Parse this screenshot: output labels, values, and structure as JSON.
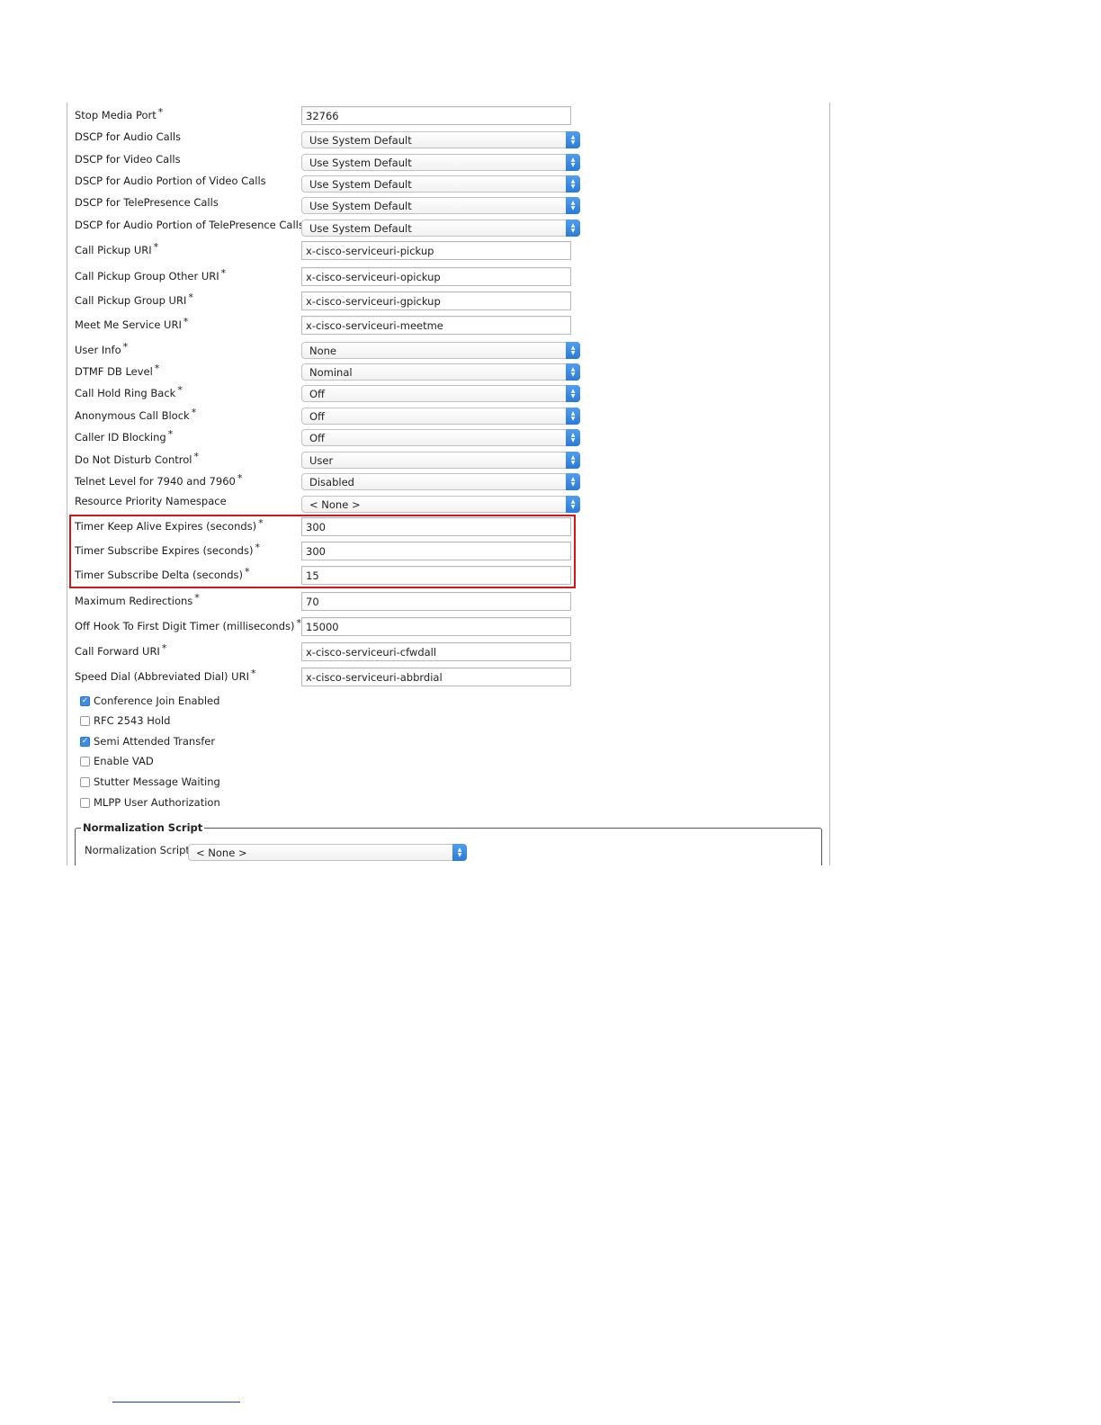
{
  "form": {
    "rows": [
      {
        "label": "Stop Media Port",
        "required": "*",
        "type": "text",
        "value": "32766"
      },
      {
        "label": "DSCP for Audio Calls",
        "required": "",
        "type": "select",
        "value": "Use System Default"
      },
      {
        "label": "DSCP for Video Calls",
        "required": "",
        "type": "select",
        "value": "Use System Default"
      },
      {
        "label": "DSCP for Audio Portion of Video Calls",
        "required": "",
        "type": "select",
        "value": "Use System Default"
      },
      {
        "label": "DSCP for TelePresence Calls",
        "required": "",
        "type": "select",
        "value": "Use System Default"
      },
      {
        "label": "DSCP for Audio Portion of TelePresence Calls",
        "required": "",
        "type": "select",
        "value": "Use System Default"
      },
      {
        "label": "Call Pickup URI",
        "required": "*",
        "type": "text",
        "value": "x-cisco-serviceuri-pickup"
      },
      {
        "label": "Call Pickup Group Other URI",
        "required": "*",
        "type": "text",
        "value": "x-cisco-serviceuri-opickup"
      },
      {
        "label": "Call Pickup Group URI",
        "required": "*",
        "type": "text",
        "value": "x-cisco-serviceuri-gpickup"
      },
      {
        "label": "Meet Me Service URI",
        "required": "*",
        "type": "text",
        "value": "x-cisco-serviceuri-meetme"
      },
      {
        "label": "User Info",
        "required": "*",
        "type": "select",
        "value": "None"
      },
      {
        "label": "DTMF DB Level",
        "required": "*",
        "type": "select",
        "value": "Nominal"
      },
      {
        "label": "Call Hold Ring Back",
        "required": "*",
        "type": "select",
        "value": "Off"
      },
      {
        "label": "Anonymous Call Block",
        "required": "*",
        "type": "select",
        "value": "Off"
      },
      {
        "label": "Caller ID Blocking",
        "required": "*",
        "type": "select",
        "value": "Off"
      },
      {
        "label": "Do Not Disturb Control",
        "required": "*",
        "type": "select",
        "value": "User"
      },
      {
        "label": "Telnet Level for 7940 and 7960",
        "required": "*",
        "type": "select",
        "value": "Disabled"
      },
      {
        "label": "Resource Priority Namespace",
        "required": "",
        "type": "select",
        "value": "< None >"
      },
      {
        "label": "Timer Keep Alive Expires (seconds)",
        "required": "*",
        "type": "text",
        "value": "300"
      },
      {
        "label": "Timer Subscribe Expires (seconds)",
        "required": "*",
        "type": "text",
        "value": "300"
      },
      {
        "label": "Timer Subscribe Delta (seconds)",
        "required": "*",
        "type": "text",
        "value": "15"
      },
      {
        "label": "Maximum Redirections",
        "required": "*",
        "type": "text",
        "value": "70"
      },
      {
        "label": "Off Hook To First Digit Timer (milliseconds)",
        "required": "*",
        "type": "text",
        "value": "15000"
      },
      {
        "label": "Call Forward URI",
        "required": "*",
        "type": "text",
        "value": "x-cisco-serviceuri-cfwdall"
      },
      {
        "label": "Speed Dial (Abbreviated Dial) URI",
        "required": "*",
        "type": "text",
        "value": "x-cisco-serviceuri-abbrdial"
      }
    ],
    "checkboxes": [
      {
        "label": "Conference Join Enabled",
        "checked": true
      },
      {
        "label": "RFC 2543 Hold",
        "checked": false
      },
      {
        "label": "Semi Attended Transfer",
        "checked": true
      },
      {
        "label": "Enable VAD",
        "checked": false
      },
      {
        "label": "Stutter Message Waiting",
        "checked": false
      },
      {
        "label": "MLPP User Authorization",
        "checked": false
      }
    ],
    "normalization": {
      "legend": "Normalization Script",
      "label": "Normalization Script",
      "value": "< None >"
    }
  },
  "colors": {
    "highlight": "#d7141a",
    "select_arrow": "#2a7ad8",
    "checkbox_checked": "#3d8ee6"
  },
  "icons": {
    "select_arrow": "up-down-chevron-icon",
    "checkbox_check": "checkmark-icon"
  }
}
